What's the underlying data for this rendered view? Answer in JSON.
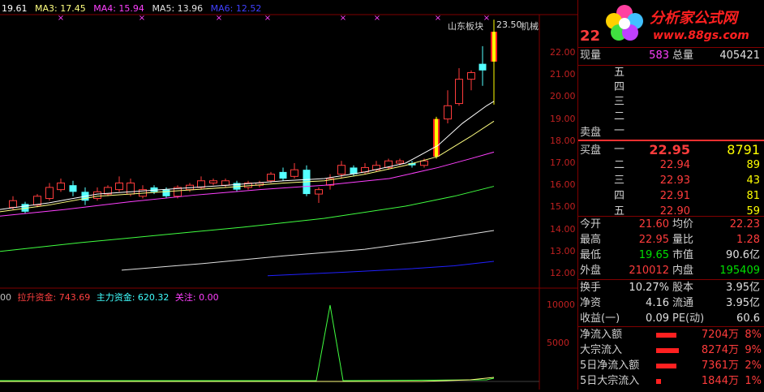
{
  "ma_legend": {
    "first": "19.61",
    "ma3": "MA3: 17.45",
    "ma4": "MA4: 15.94",
    "ma5": "MA5: 13.96",
    "ma6": "MA6: 12.52"
  },
  "indicator_legend": {
    "prefix": "00",
    "lashengzijin": "拉升资金: 743.69",
    "zhulizijin": "主力资金: 620.32",
    "guanzhu": "关注: 0.00"
  },
  "chart_labels": {
    "board_tag": "山东板块",
    "mech_tag": "机械",
    "peak_price": "23.50",
    "y_ticks": [
      "22.00",
      "21.00",
      "20.00",
      "19.00",
      "18.00",
      "17.00",
      "16.00",
      "15.00",
      "14.00",
      "13.00",
      "12.00"
    ],
    "ind_ticks": [
      "10000",
      "5000"
    ]
  },
  "colors": {
    "up": "#ff3c3c",
    "down": "#54ffff",
    "ma1": "#ffffff",
    "ma2": "#ffff80",
    "ma3": "#ff40ff",
    "ma4": "#40ff40",
    "ma5": "#e0e0e0",
    "ma6": "#2020ff"
  },
  "header": {
    "price": "22",
    "logo": "分析家公式网",
    "url": "www.88gs.com"
  },
  "summary": {
    "xianliang_label": "现量",
    "xianliang": "583",
    "zongliang_label": "总量",
    "zongliang": "405421"
  },
  "sell_label": "卖盘",
  "buy_label": "买盘",
  "sell_levels": [
    "五",
    "四",
    "三",
    "二",
    "一"
  ],
  "buy_levels": [
    {
      "level": "一",
      "price": "22.95",
      "vol": "8791"
    },
    {
      "level": "二",
      "price": "22.94",
      "vol": "89"
    },
    {
      "level": "三",
      "price": "22.93",
      "vol": "43"
    },
    {
      "level": "四",
      "price": "22.91",
      "vol": "81"
    },
    {
      "level": "五",
      "price": "22.90",
      "vol": "59"
    }
  ],
  "stats": [
    {
      "l1": "今开",
      "v1": "21.60",
      "l2": "均价",
      "v2": "22.23"
    },
    {
      "l1": "最高",
      "v1": "22.95",
      "l2": "量比",
      "v2": "1.28"
    },
    {
      "l1": "最低",
      "v1": "19.65",
      "l2": "市值",
      "v2": "90.6亿"
    },
    {
      "l1": "外盘",
      "v1": "210012",
      "l2": "内盘",
      "v2": "195409"
    }
  ],
  "fundamentals": [
    {
      "l1": "换手",
      "v1": "10.27%",
      "l2": "股本",
      "v2": "3.95亿"
    },
    {
      "l1": "净资",
      "v1": "4.16",
      "l2": "流通",
      "v2": "3.95亿"
    },
    {
      "l1": "收益(一)",
      "v1": "0.09",
      "l2": "PE(动)",
      "v2": "60.6"
    }
  ],
  "flows": [
    {
      "label": "净流入额",
      "bar": 0.62,
      "value": "7204万",
      "pct": "8%"
    },
    {
      "label": "大宗流入",
      "bar": 0.7,
      "value": "8274万",
      "pct": "9%"
    },
    {
      "label": "5日净流入额",
      "bar": 0.62,
      "value": "7361万",
      "pct": "2%"
    },
    {
      "label": "5日大宗流入",
      "bar": 0.15,
      "value": "1844万",
      "pct": "1%"
    }
  ]
}
